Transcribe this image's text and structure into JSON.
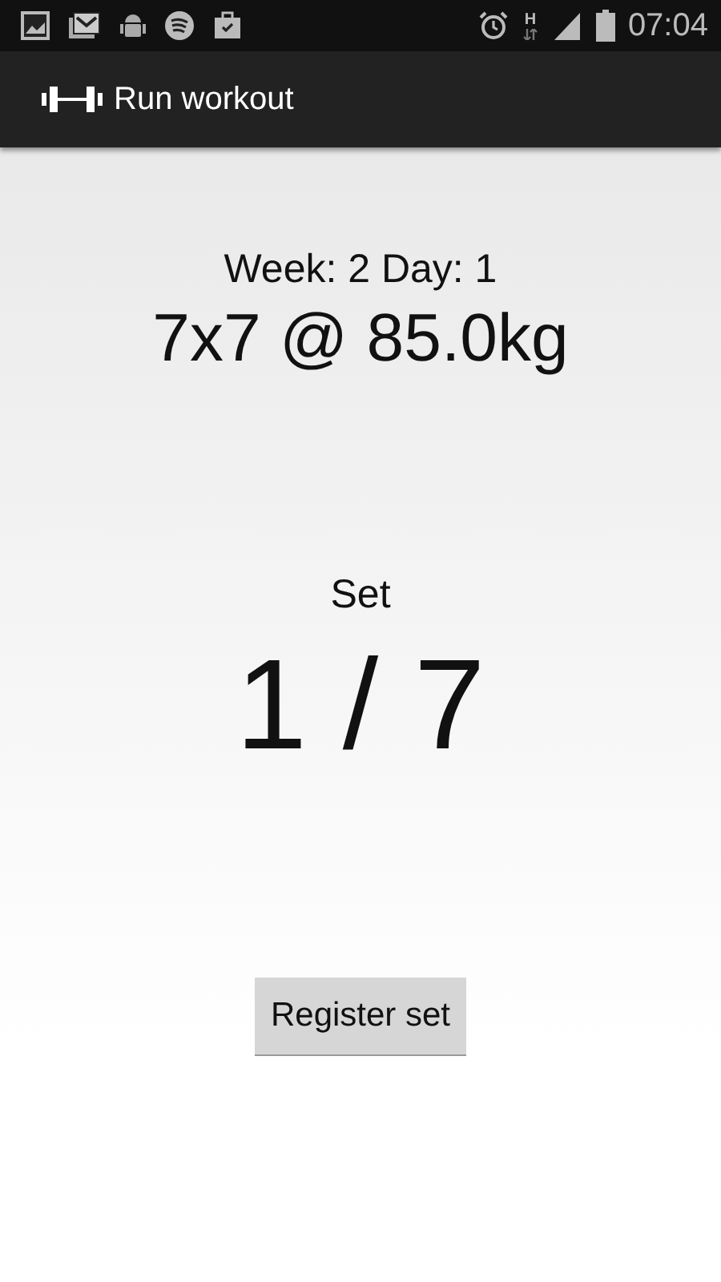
{
  "status_bar": {
    "network_type": "H",
    "time": "07:04"
  },
  "action_bar": {
    "title": "Run workout"
  },
  "workout": {
    "week_day": "Week: 2 Day: 1",
    "prescription": "7x7 @ 85.0kg"
  },
  "set": {
    "label": "Set",
    "progress": "1 / 7"
  },
  "buttons": [
    "Register set"
  ]
}
